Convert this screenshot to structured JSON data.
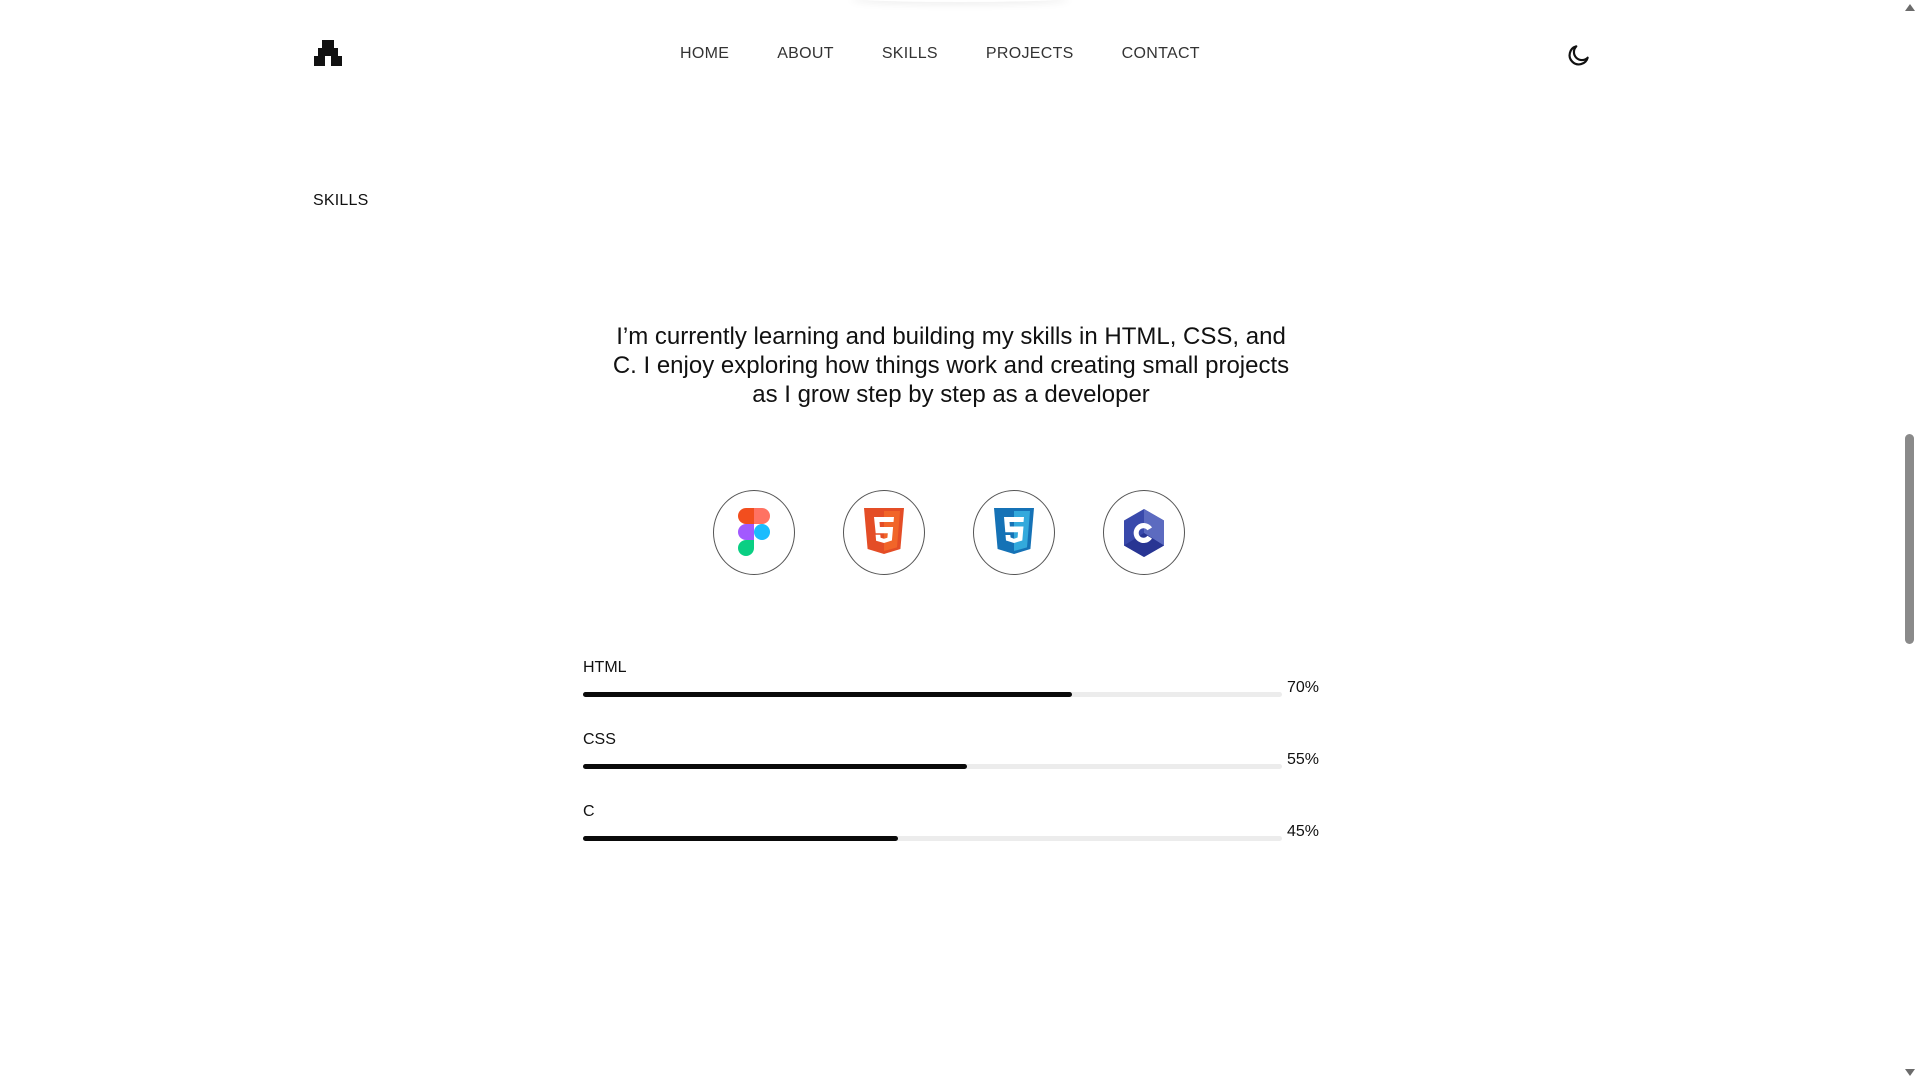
{
  "nav": {
    "items": [
      {
        "label": "HOME"
      },
      {
        "label": "ABOUT"
      },
      {
        "label": "SKILLS"
      },
      {
        "label": "PROJECTS"
      },
      {
        "label": "CONTACT"
      }
    ],
    "theme_icon": "moon-icon",
    "logo_icon": "pixel-logo-icon"
  },
  "section": {
    "label": "SKILLS"
  },
  "intro": {
    "line1": "I’m currently learning and building my skills in HTML, CSS, and",
    "line2": "C. I enjoy exploring how things work and creating small projects",
    "line3": "as I grow step by step as a developer"
  },
  "icons": [
    {
      "name": "figma-icon",
      "colors": [
        "#f24e1e",
        "#ff7262",
        "#a259ff",
        "#1abcfe",
        "#0acf83"
      ]
    },
    {
      "name": "html5-icon",
      "colors": [
        "#e44d26",
        "#f16529",
        "#ffffff"
      ]
    },
    {
      "name": "css3-icon",
      "colors": [
        "#1572b6",
        "#33a9dc",
        "#ffffff"
      ]
    },
    {
      "name": "c-language-icon",
      "colors": [
        "#283593",
        "#3949ab",
        "#5c6bc0",
        "#ffffff"
      ]
    }
  ],
  "skills": [
    {
      "name": "HTML",
      "percent_label": "70%",
      "value": 0.7
    },
    {
      "name": "CSS",
      "percent_label": "55%",
      "value": 0.55
    },
    {
      "name": "C",
      "percent_label": "45%",
      "value": 0.45
    }
  ],
  "colors": {
    "bar_fill": "#0a0a0a",
    "bar_track": "#ececec",
    "text": "#111111"
  }
}
